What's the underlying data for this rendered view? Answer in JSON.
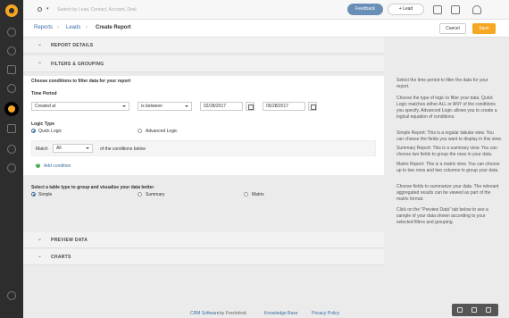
{
  "topbar": {
    "search_placeholder": "Search by Lead, Contact, Account, Deal",
    "search_dropdown_glyph": "▾",
    "feedback_label": "Feedback",
    "add_lead_label": "+ Lead"
  },
  "breadcrumb": {
    "reports": "Reports",
    "sep1": "›",
    "leads": "Leads",
    "sep2": "›",
    "current": "Create Report"
  },
  "actions": {
    "cancel": "Cancel",
    "save": "Save"
  },
  "sections": {
    "report_details": "REPORT DETAILS",
    "filters_grouping": "FILTERS & GROUPING",
    "preview_data": "PREVIEW DATA",
    "charts": "CHARTS",
    "chevron_collapsed": "⌄",
    "chevron_expanded": "⌃"
  },
  "filters": {
    "heading": "Choose conditions to filter data for your report",
    "time_period_label": "Time Period",
    "field_value": "Created at",
    "operator_value": "is between",
    "date_from": "02/28/2017",
    "date_to": "05/28/2017",
    "logic_type_label": "Logic Type",
    "logic_quick": "Quick Logic",
    "logic_advanced": "Advanced Logic",
    "match_label": "Match",
    "match_value": "All",
    "match_suffix": "of the conditions below",
    "add_condition": "Add condition"
  },
  "grouping": {
    "heading": "Select a table type to group and visualise your data better",
    "simple": "Simple",
    "summary": "Summary",
    "matrix": "Matrix"
  },
  "help": {
    "p1": "Select the time period to filter the data for your report.",
    "p2": "Choose the type of logic to filter your data. Quick Logic matches either ALL or ANY of the conditions you specify. Advanced Logic allows you to create a logical equation of conditions.",
    "p3": "Simple Report: This is a regular tabular view. You can choose the fields you want to display in this view.",
    "p4": "Summary Report: This is a summary view. You can choose two fields to group the rows in your data.",
    "p5": "Matrix Report: This is a matrix view. You can choose up to two rows and two columns to group your data.",
    "p6": "Choose fields to summarize your data. The relevant aggregated results can be viewed as part of the matrix format.",
    "p7": "Click on the \"Preview Data\" tab below to see a sample of your data shown according to your selected filters and grouping."
  },
  "footer": {
    "crm_software": "CRM Software",
    "by_freshdesk": "by Freshdesk",
    "knowledge_base": "Knowledge Base",
    "privacy_policy": "Privacy Policy"
  },
  "colors": {
    "accent": "#f5a623",
    "link": "#3a6ea5",
    "sidebar": "#2d2d2d"
  }
}
